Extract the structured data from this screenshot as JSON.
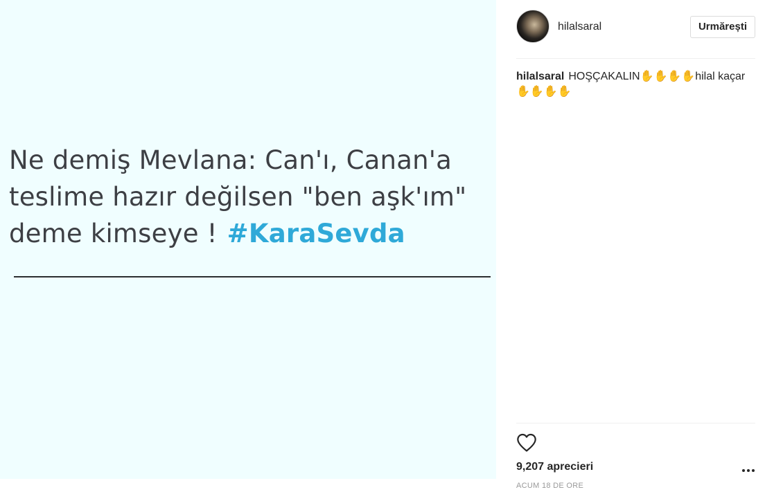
{
  "post": {
    "image": {
      "quote_text": "Ne demiş Mevlana: Can'ı, Canan'a teslime hazır değilsen \"ben aşk'ım\" deme kimseye !",
      "hashtag": "#KaraSevda",
      "quote_color": "#3d3f44",
      "hashtag_color": "#2fa9d8",
      "background_color": "#f0feff"
    },
    "header": {
      "username": "hilalsaral",
      "follow_label": "Urmărești"
    },
    "caption": {
      "username": "hilalsaral",
      "text_before": "HOŞÇAKALIN",
      "hands_1": "✋✋✋✋",
      "text_mid": "hilal kaçar",
      "hands_2": "✋✋✋✋",
      "emoji_icon": "raised-hand-emoji",
      "emoji_color": "#f2b731"
    },
    "footer": {
      "likes_label": "9,207 aprecieri",
      "timestamp": "ACUM 18 DE ORE",
      "like_icon": "heart-outline-icon",
      "more_icon": "ellipsis-icon"
    }
  }
}
